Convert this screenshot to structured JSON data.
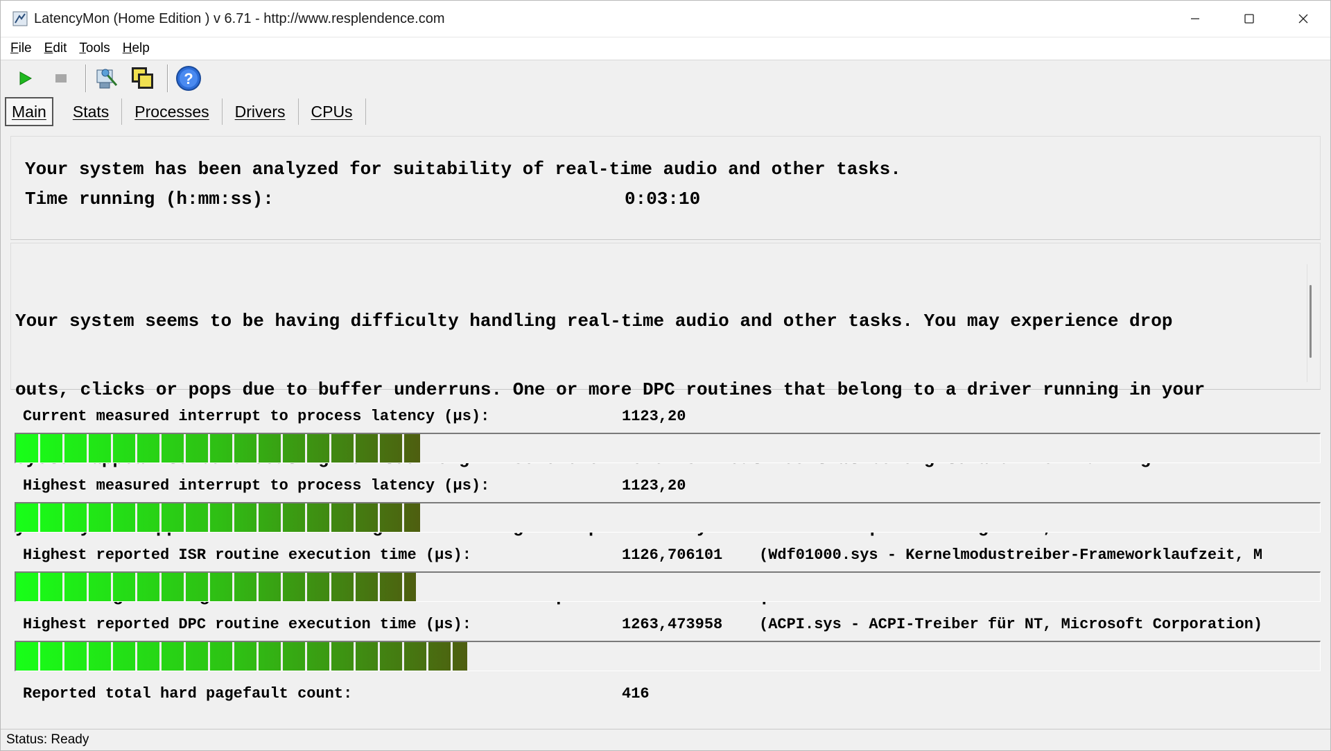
{
  "window": {
    "title": "LatencyMon  (Home Edition )  v 6.71 - http://www.resplendence.com"
  },
  "menu": {
    "items": [
      {
        "first": "F",
        "rest": "ile"
      },
      {
        "first": "E",
        "rest": "dit"
      },
      {
        "first": "T",
        "rest": "ools"
      },
      {
        "first": "H",
        "rest": "elp"
      }
    ]
  },
  "toolbar": {
    "icons": [
      "play-icon",
      "stop-icon",
      "driver-analysis-icon",
      "copy-icon",
      "help-icon"
    ]
  },
  "tabs": [
    {
      "label": "Main",
      "active": true
    },
    {
      "label": "Stats",
      "active": false
    },
    {
      "label": "Processes",
      "active": false
    },
    {
      "label": "Drivers",
      "active": false
    },
    {
      "label": "CPUs",
      "active": false
    }
  ],
  "summary": {
    "analyzed_text": "Your system has been analyzed for suitability of real-time audio and other tasks.",
    "time_label": "Time running (h:mm:ss):",
    "time_value": "0:03:10"
  },
  "verdict": {
    "lines": [
      "Your system seems to be having difficulty handling real-time audio and other tasks. You may experience drop",
      "outs, clicks or pops due to buffer underruns. One or more DPC routines that belong to a driver running in your",
      "system appear to be executing for too long. Also one or more ISR routines that belong to a driver running in",
      "your system appear to be executing for too long. One problem may be related to power management, disable CPU",
      "throttling settings in Control Panel and BIOS setup. Check for BIOS updates."
    ]
  },
  "metrics": [
    {
      "label": "Current measured interrupt to process latency (µs):",
      "value": "1123,20",
      "detail": "",
      "bar_fraction": 0.31
    },
    {
      "label": "Highest measured interrupt to process latency (µs):",
      "value": "1123,20",
      "detail": "",
      "bar_fraction": 0.31
    },
    {
      "label": "Highest reported ISR routine execution time (µs):",
      "value": "1126,706101",
      "detail": "(Wdf01000.sys - Kernelmodustreiber-Frameworklaufzeit, M",
      "bar_fraction": 0.307
    },
    {
      "label": "Highest reported DPC routine execution time (µs):",
      "value": "1263,473958",
      "detail": "(ACPI.sys - ACPI-Treiber für NT, Microsoft Corporation)",
      "bar_fraction": 0.346
    }
  ],
  "pagefault": {
    "label": "Reported total hard pagefault count:",
    "value": "416"
  },
  "status": {
    "text": "Status: Ready"
  }
}
